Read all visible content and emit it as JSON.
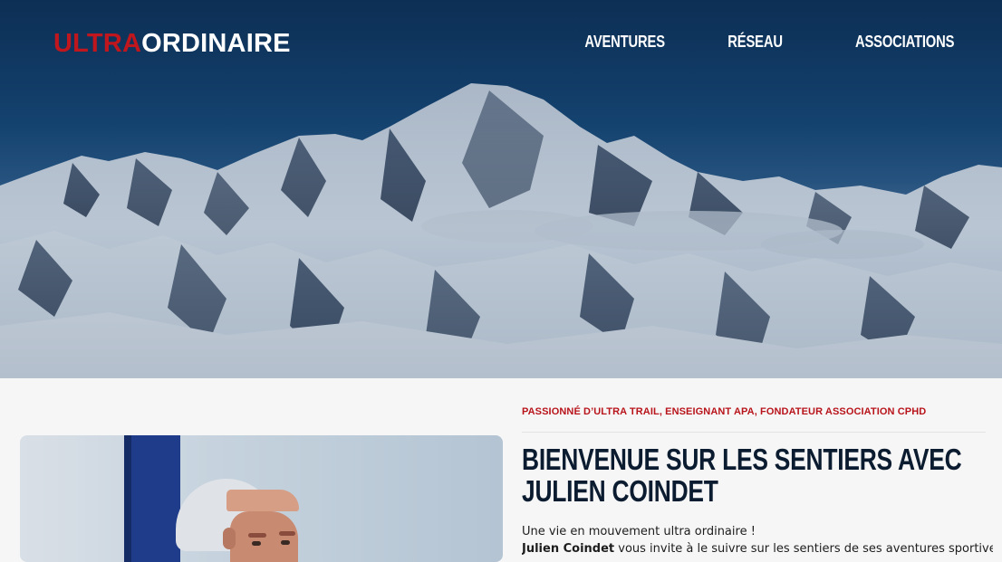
{
  "header": {
    "logo_part1": "ULTRA",
    "logo_part2": "ORDINAIRE",
    "nav": [
      {
        "label": "AVENTURES"
      },
      {
        "label": "RÉSEAU"
      },
      {
        "label": "ASSOCIATIONS"
      }
    ]
  },
  "intro": {
    "kicker": "PASSIONNÉ D’ULTRA TRAIL, ENSEIGNANT APA, FONDATEUR ASSOCIATION CPHD",
    "headline": "BIENVENUE SUR LES SENTIERS AVEC JULIEN COINDET",
    "line1": "Une vie en mouvement ultra ordinaire !",
    "line2_name": "Julien Coindet",
    "line2_rest": " vous invite à le suivre sur les sentiers de ses aventures sportives"
  },
  "colors": {
    "brand_red": "#c0161d",
    "heading_navy": "#0c1c30"
  }
}
